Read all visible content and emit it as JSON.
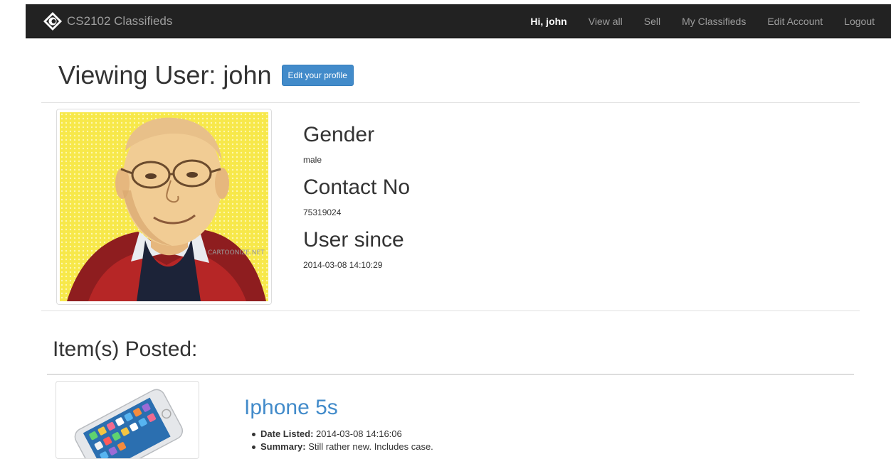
{
  "navbar": {
    "brand": "CS2102 Classifieds",
    "greeting": "Hi, john",
    "links": [
      "View all",
      "Sell",
      "My Classifieds",
      "Edit Account",
      "Logout"
    ]
  },
  "header": {
    "title": "Viewing User: john",
    "edit_button": "Edit your profile"
  },
  "profile": {
    "avatar_watermark": "CARTOONIZE.NET",
    "fields": [
      {
        "label": "Gender",
        "value": "male"
      },
      {
        "label": "Contact No",
        "value": "75319024"
      },
      {
        "label": "User since",
        "value": "2014-03-08 14:10:29"
      }
    ]
  },
  "items_section": {
    "title": "Item(s) Posted:",
    "items": [
      {
        "title": "Iphone 5s",
        "date_label": "Date Listed:",
        "date_value": "2014-03-08 14:16:06",
        "summary_label": "Summary:",
        "summary_value": "Still rather new. Includes case."
      }
    ]
  },
  "colors": {
    "navbar_bg": "#222222",
    "link_blue": "#428bca",
    "button_blue": "#428bca"
  }
}
